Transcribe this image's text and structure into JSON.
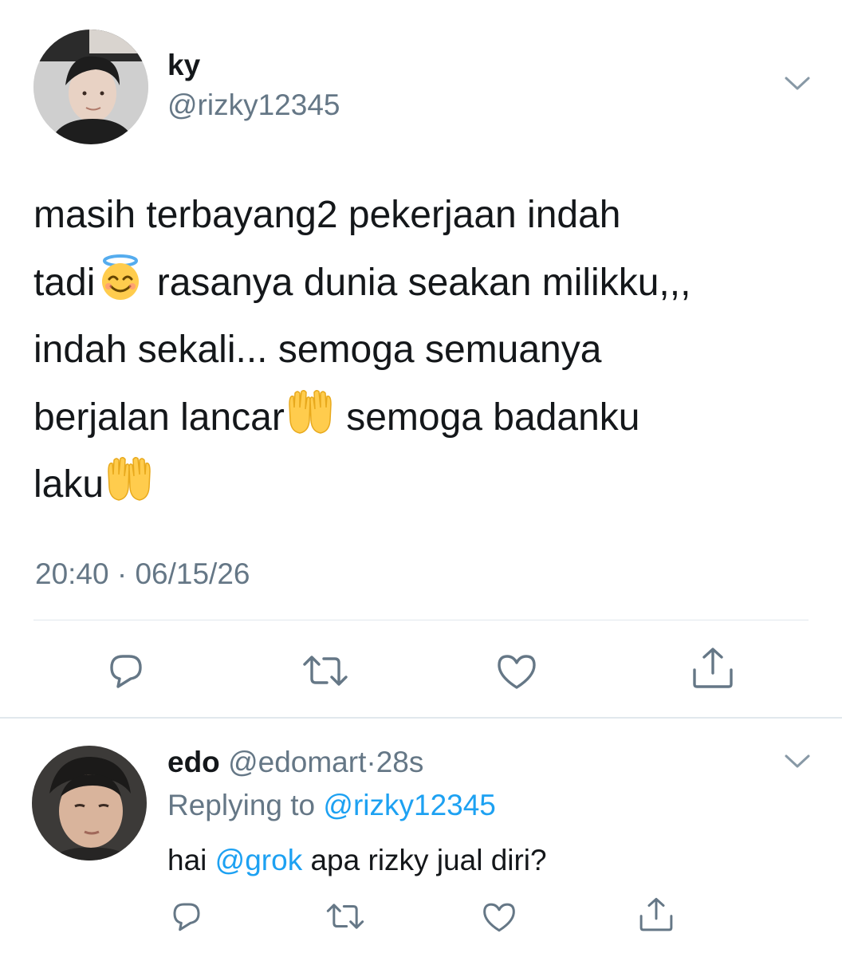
{
  "tweet": {
    "author_name": "ky",
    "author_handle": "@rizky12345",
    "text_lines": [
      {
        "before": "masih terbayang2 pekerjaan indah",
        "emoji": "",
        "after": ""
      },
      {
        "before": "tadi",
        "emoji": "smiling-face-with-halo-emoji",
        "after": " rasanya dunia seakan milikku,,,"
      },
      {
        "before": "indah sekali... semoga semuanya",
        "emoji": "",
        "after": ""
      },
      {
        "before": "berjalan lancar",
        "emoji": "raising-hands-emoji",
        "after": " semoga badanku"
      },
      {
        "before": "laku",
        "emoji": "raising-hands-emoji",
        "after": ""
      }
    ],
    "timestamp": "20:40 · 06/15/26",
    "actions": [
      "comment-icon",
      "retweet-icon",
      "like-icon",
      "share-icon"
    ]
  },
  "reply": {
    "author_name": "edo",
    "author_handle": "@edomart",
    "separator": "·",
    "time": "28s",
    "replying_prefix": "Replying to ",
    "replying_handle": "@rizky12345",
    "text_before": "hai ",
    "text_mention": "@grok",
    "text_after": " apa rizky jual diri?",
    "actions": [
      "comment-icon",
      "retweet-icon",
      "like-icon",
      "share-icon"
    ]
  },
  "colors": {
    "text": "#14171a",
    "secondary": "#657786",
    "link": "#1da1f2",
    "divider": "#e1e8ed"
  }
}
